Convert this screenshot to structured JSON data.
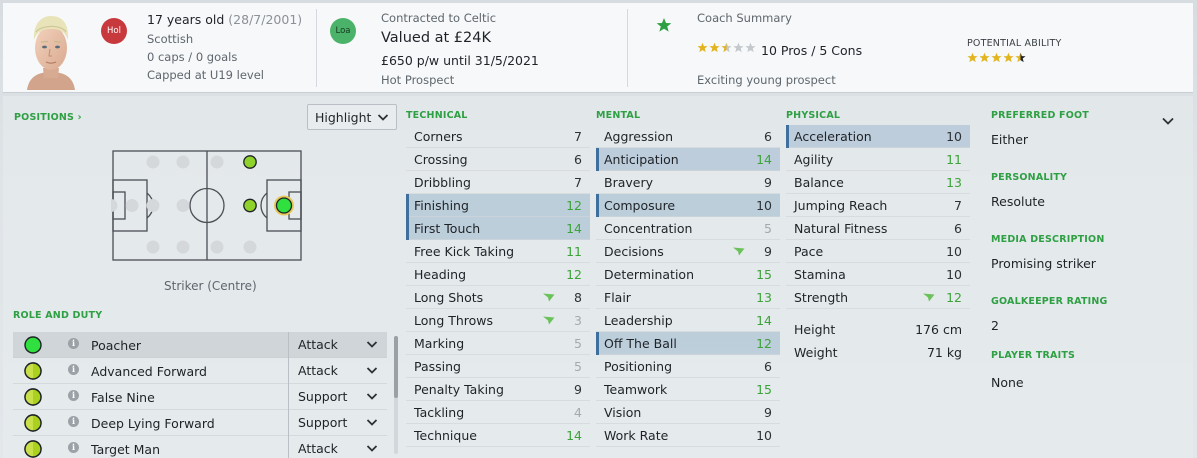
{
  "header": {
    "age": "17 years old",
    "dob": "(28/7/2001)",
    "nationality": "Scottish",
    "caps_goals": "0 caps / 0 goals",
    "capped_level": "Capped at U19 level",
    "nation_badge": "Hol",
    "contract_badge": "Loa",
    "contracted_to": "Contracted to Celtic",
    "valued_at": "Valued at £24K",
    "wage": "£650 p/w until 31/5/2021",
    "status": "Hot Prospect",
    "coach_summary_label": "Coach Summary",
    "coach_stars": 2.5,
    "pros_cons": "10 Pros / 5 Cons",
    "summary_text": "Exciting young prospect",
    "potential_label": "POTENTIAL ABILITY",
    "potential_stars": 4.5
  },
  "positions": {
    "title": "POSITIONS",
    "highlight_label": "Highlight",
    "position_caption": "Striker (Centre)"
  },
  "roles": {
    "title": "ROLE AND DUTY",
    "items": [
      {
        "name": "Poacher",
        "duty": "Attack",
        "rating": "full",
        "selected": true
      },
      {
        "name": "Advanced Forward",
        "duty": "Attack",
        "rating": "half",
        "selected": false
      },
      {
        "name": "False Nine",
        "duty": "Support",
        "rating": "half",
        "selected": false
      },
      {
        "name": "Deep Lying Forward",
        "duty": "Support",
        "rating": "half",
        "selected": false
      },
      {
        "name": "Target Man",
        "duty": "Attack",
        "rating": "half",
        "selected": false
      }
    ]
  },
  "technical": {
    "title": "TECHNICAL",
    "items": [
      {
        "name": "Corners",
        "value": "7",
        "tone": "dark"
      },
      {
        "name": "Crossing",
        "value": "6",
        "tone": "dark"
      },
      {
        "name": "Dribbling",
        "value": "7",
        "tone": "dark"
      },
      {
        "name": "Finishing",
        "value": "12",
        "tone": "green",
        "hl": true
      },
      {
        "name": "First Touch",
        "value": "14",
        "tone": "green",
        "hl": true
      },
      {
        "name": "Free Kick Taking",
        "value": "11",
        "tone": "green"
      },
      {
        "name": "Heading",
        "value": "12",
        "tone": "green"
      },
      {
        "name": "Long Shots",
        "value": "8",
        "tone": "dark",
        "arrow": true
      },
      {
        "name": "Long Throws",
        "value": "3",
        "tone": "faint",
        "arrow": true
      },
      {
        "name": "Marking",
        "value": "5",
        "tone": "faint"
      },
      {
        "name": "Passing",
        "value": "5",
        "tone": "faint"
      },
      {
        "name": "Penalty Taking",
        "value": "9",
        "tone": "dark"
      },
      {
        "name": "Tackling",
        "value": "4",
        "tone": "faint"
      },
      {
        "name": "Technique",
        "value": "14",
        "tone": "green"
      }
    ]
  },
  "mental": {
    "title": "MENTAL",
    "items": [
      {
        "name": "Aggression",
        "value": "6",
        "tone": "dark"
      },
      {
        "name": "Anticipation",
        "value": "14",
        "tone": "green",
        "hl": true
      },
      {
        "name": "Bravery",
        "value": "9",
        "tone": "dark"
      },
      {
        "name": "Composure",
        "value": "10",
        "tone": "dark",
        "hl": true
      },
      {
        "name": "Concentration",
        "value": "5",
        "tone": "faint"
      },
      {
        "name": "Decisions",
        "value": "9",
        "tone": "dark",
        "arrow": true
      },
      {
        "name": "Determination",
        "value": "15",
        "tone": "green"
      },
      {
        "name": "Flair",
        "value": "13",
        "tone": "green"
      },
      {
        "name": "Leadership",
        "value": "14",
        "tone": "green"
      },
      {
        "name": "Off The Ball",
        "value": "12",
        "tone": "green",
        "hl": true
      },
      {
        "name": "Positioning",
        "value": "6",
        "tone": "dark"
      },
      {
        "name": "Teamwork",
        "value": "15",
        "tone": "green"
      },
      {
        "name": "Vision",
        "value": "9",
        "tone": "dark"
      },
      {
        "name": "Work Rate",
        "value": "10",
        "tone": "dark"
      }
    ]
  },
  "physical": {
    "title": "PHYSICAL",
    "items": [
      {
        "name": "Acceleration",
        "value": "10",
        "tone": "dark",
        "hl": true
      },
      {
        "name": "Agility",
        "value": "11",
        "tone": "green"
      },
      {
        "name": "Balance",
        "value": "13",
        "tone": "green"
      },
      {
        "name": "Jumping Reach",
        "value": "7",
        "tone": "dark"
      },
      {
        "name": "Natural Fitness",
        "value": "6",
        "tone": "dark"
      },
      {
        "name": "Pace",
        "value": "10",
        "tone": "dark"
      },
      {
        "name": "Stamina",
        "value": "10",
        "tone": "dark"
      },
      {
        "name": "Strength",
        "value": "12",
        "tone": "green",
        "arrow": true
      }
    ],
    "height_label": "Height",
    "height_value": "176 cm",
    "weight_label": "Weight",
    "weight_value": "71 kg"
  },
  "info": {
    "preferred_foot_label": "PREFERRED FOOT",
    "preferred_foot": "Either",
    "personality_label": "PERSONALITY",
    "personality": "Resolute",
    "media_label": "MEDIA DESCRIPTION",
    "media": "Promising striker",
    "gk_label": "GOALKEEPER RATING",
    "gk": "2",
    "traits_label": "PLAYER TRAITS",
    "traits": "None"
  },
  "colors": {
    "accent_green": "#2ea043",
    "value_green": "#3ea23a",
    "highlight_row": "#b0c4d6",
    "nation_badge": "#c8393d",
    "contract_badge": "#4bb26a"
  }
}
